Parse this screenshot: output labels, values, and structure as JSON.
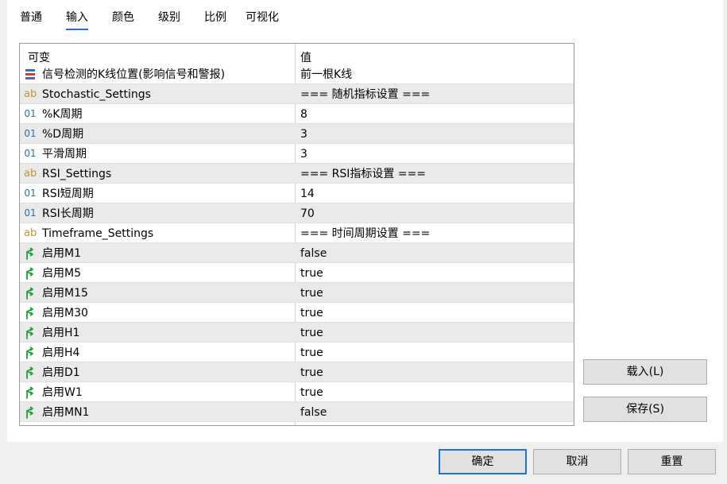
{
  "tabs": [
    "普通",
    "输入",
    "颜色",
    "级别",
    "比例",
    "可视化"
  ],
  "active_tab": "输入",
  "grid": {
    "header": {
      "name": "可变",
      "value": "值"
    },
    "rows": [
      {
        "icon": "enum-icon",
        "name": "信号检测的K线位置(影响信号和警报)",
        "value": "前一根K线"
      },
      {
        "icon": "string-icon",
        "name": "Stochastic_Settings",
        "value": "=== 随机指标设置 ==="
      },
      {
        "icon": "integer-icon",
        "name": "%K周期",
        "value": "8"
      },
      {
        "icon": "integer-icon",
        "name": "%D周期",
        "value": "3"
      },
      {
        "icon": "integer-icon",
        "name": "平滑周期",
        "value": "3"
      },
      {
        "icon": "string-icon",
        "name": "RSI_Settings",
        "value": "=== RSI指标设置 ==="
      },
      {
        "icon": "integer-icon",
        "name": "RSI短周期",
        "value": "14"
      },
      {
        "icon": "integer-icon",
        "name": "RSI长周期",
        "value": "70"
      },
      {
        "icon": "string-icon",
        "name": "Timeframe_Settings",
        "value": "=== 时间周期设置 ==="
      },
      {
        "icon": "boolean-icon",
        "name": "启用M1",
        "value": "false"
      },
      {
        "icon": "boolean-icon",
        "name": "启用M5",
        "value": "true"
      },
      {
        "icon": "boolean-icon",
        "name": "启用M15",
        "value": "true"
      },
      {
        "icon": "boolean-icon",
        "name": "启用M30",
        "value": "true"
      },
      {
        "icon": "boolean-icon",
        "name": "启用H1",
        "value": "true"
      },
      {
        "icon": "boolean-icon",
        "name": "启用H4",
        "value": "true"
      },
      {
        "icon": "boolean-icon",
        "name": "启用D1",
        "value": "true"
      },
      {
        "icon": "boolean-icon",
        "name": "启用W1",
        "value": "true"
      },
      {
        "icon": "boolean-icon",
        "name": "启用MN1",
        "value": "false"
      }
    ]
  },
  "side_buttons": {
    "load": "载入(L)",
    "save": "保存(S)"
  },
  "footer_buttons": {
    "ok": "确定",
    "cancel": "取消",
    "reset": "重置"
  },
  "colors": {
    "accent": "#1a73d9",
    "string_icon": "#c8902a",
    "integer_icon": "#2a6fb5",
    "boolean_icon": "#1e9e3a"
  }
}
